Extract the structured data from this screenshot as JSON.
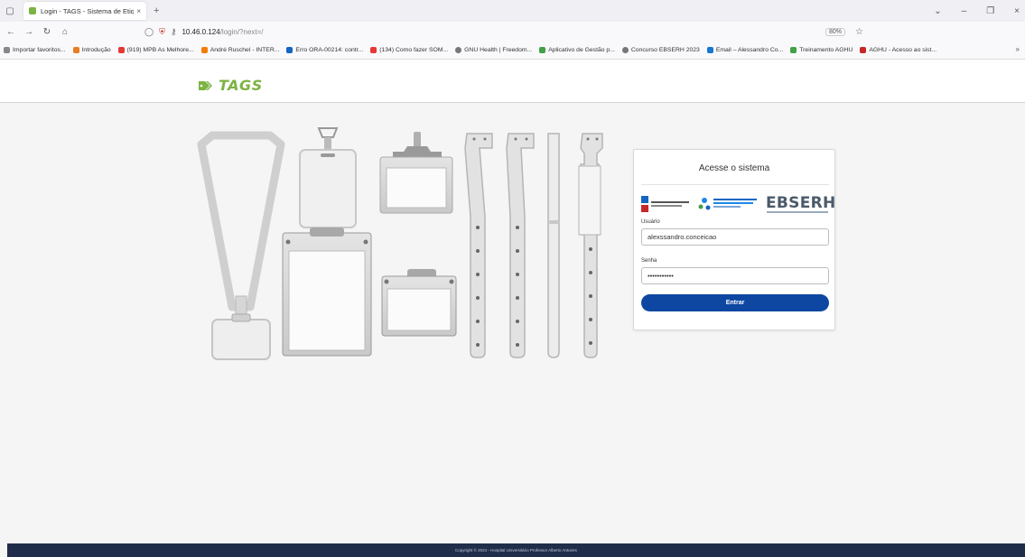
{
  "browser": {
    "tab": {
      "title": "Login - TAGS - Sistema de Etiqu",
      "close": "×"
    },
    "new_tab": "+",
    "url": {
      "host": "10.46.0.124",
      "path": "/login/?next=/",
      "zoom": "80%"
    },
    "window_controls": [
      "⌄",
      "–",
      "❐",
      "×"
    ],
    "bookmarks": [
      {
        "label": "Importar favoritos...",
        "color": "#888888"
      },
      {
        "label": "Introdução",
        "color": "#e67e22"
      },
      {
        "label": "(919) MPB As Melhore...",
        "color": "#e53935"
      },
      {
        "label": "André Ruschel - INTER...",
        "color": "#f57c00"
      },
      {
        "label": "Erro ORA-00214: contr...",
        "color": "#1565c0"
      },
      {
        "label": "(134) Como fazer SOM...",
        "color": "#e53935"
      },
      {
        "label": "GNU Health | Freedom...",
        "color": "#777777"
      },
      {
        "label": "Aplicativo de Gestão p...",
        "color": "#43a047"
      },
      {
        "label": "Concurso EBSERH 2023",
        "color": "#777777"
      },
      {
        "label": "Email – Alessandro Co...",
        "color": "#1976d2"
      },
      {
        "label": "Treinamento AGHU",
        "color": "#43a047"
      },
      {
        "label": "AGHU - Acesso ao sist...",
        "color": "#c62828"
      }
    ]
  },
  "app": {
    "logo_text": "TAGS",
    "brand_color": "#7cb342"
  },
  "login": {
    "title": "Acesse o sistema",
    "partner_logo_text": "EBSERH",
    "user_label": "Usuário",
    "user_value": "alexssandro.conceicao",
    "password_label": "Senha",
    "password_value": "•••••••••••",
    "submit_label": "Entrar",
    "button_color": "#0d47a1"
  },
  "footer": {
    "text": "Copyright © 2024 - Hospital Universitário Professor Alberto Antunes"
  }
}
